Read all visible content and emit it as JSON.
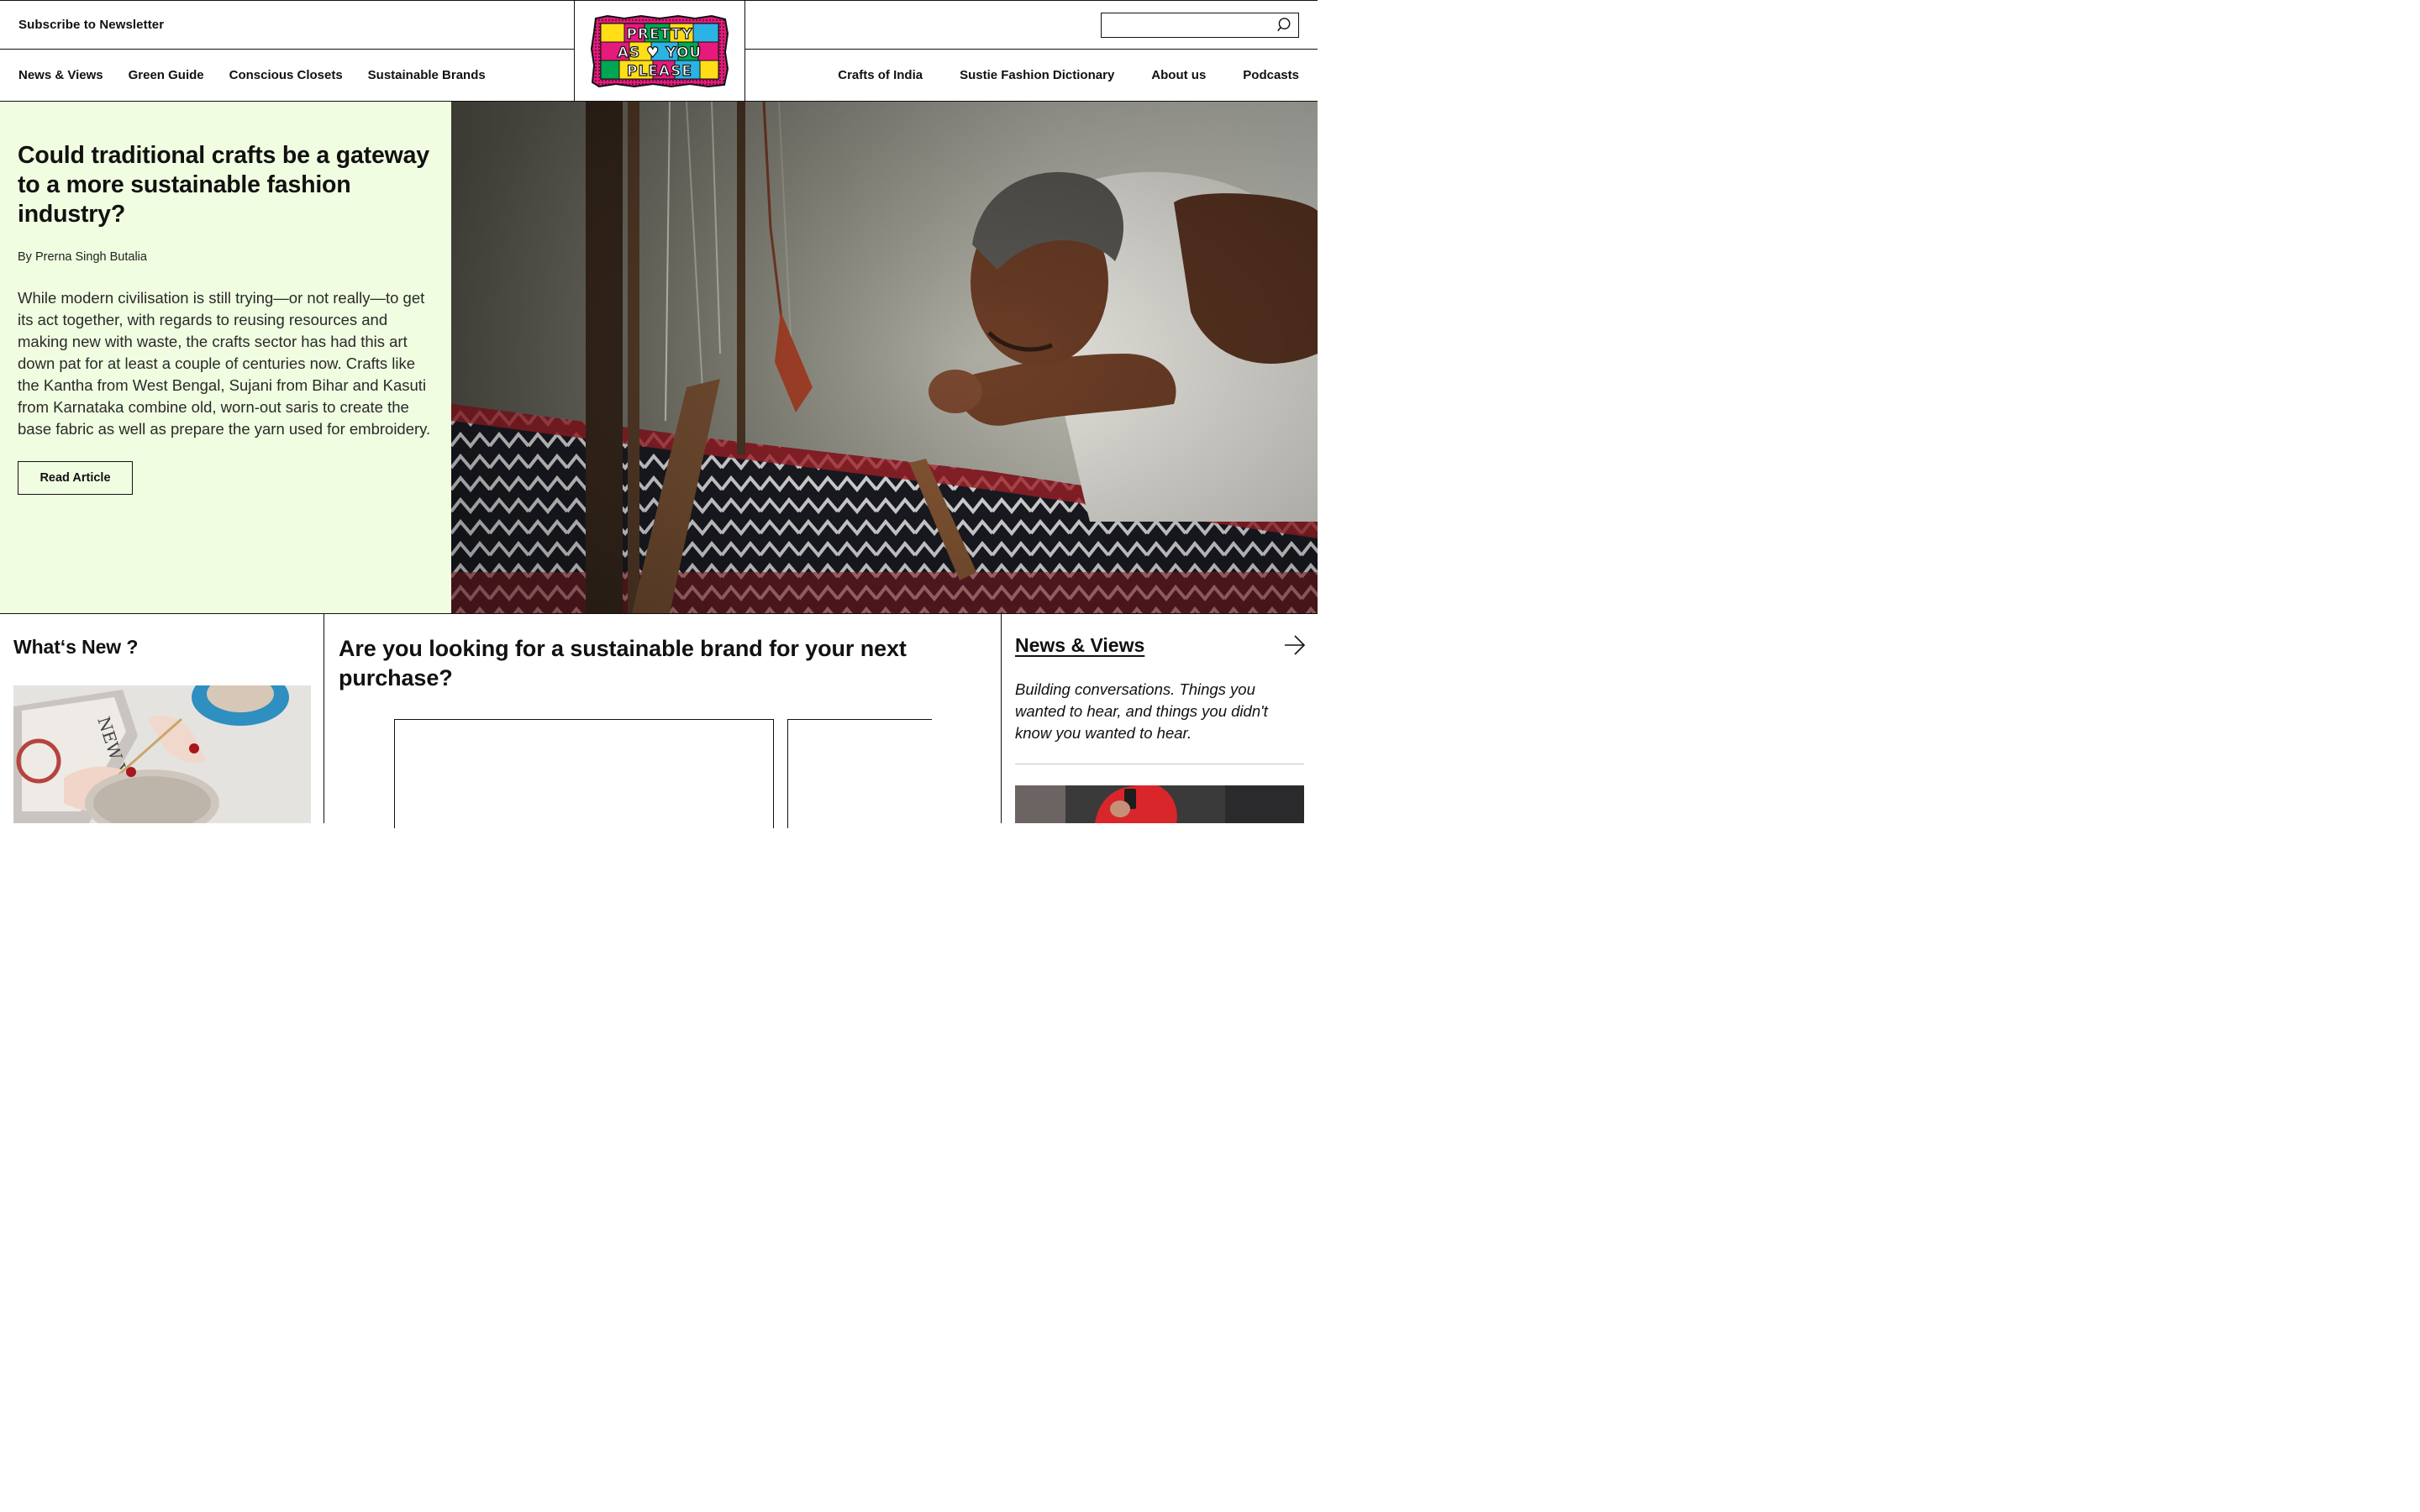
{
  "header": {
    "subscribe_label": "Subscribe to Newsletter",
    "left_nav": [
      "News & Views",
      "Green Guide",
      "Conscious Closets",
      "Sustainable Brands"
    ],
    "right_nav": [
      "Crafts of India",
      "Sustie Fashion Dictionary",
      "About us",
      "Podcasts"
    ],
    "search": {
      "value": "",
      "placeholder": ""
    },
    "logo": {
      "text": "PRETTY AS YOU PLEASE",
      "colors": [
        "#e6197d",
        "#ffde17",
        "#2bb3e4",
        "#00a651",
        "#111111"
      ]
    }
  },
  "hero": {
    "title": "Could traditional crafts be a gateway to a more sustainable fashion industry?",
    "author": "By Prerna Singh Butalia",
    "body": "While modern civilisation is still trying—or not really—to get its act together, with regards to reusing resources and making new with waste, the crafts sector has had this art down pat for at least a couple of centuries now. Crafts like the Kantha from West Bengal, Sujani from Bihar and Kasuti from Karnataka combine old, worn-out saris to create the base fabric as well as prepare the yarn used for embroidery.",
    "cta_label": "Read Article",
    "background_color": "#f0fde0",
    "image": "weaver-at-handloom"
  },
  "whats_new": {
    "heading": "What‘s New ?",
    "image": "hands-knitting-with-magazine-and-coffee"
  },
  "brands": {
    "heading": "Are you looking for a sustainable brand for your next purchase?"
  },
  "news_views": {
    "heading": "News & Views",
    "arrow_icon": "arrow-right-icon",
    "body": "Building conversations. Things you wanted to hear, and things you didn't know you wanted to hear.",
    "image": "person-in-red-with-phone"
  }
}
